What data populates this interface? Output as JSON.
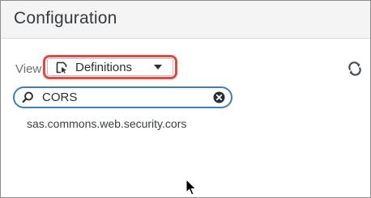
{
  "header": {
    "title": "Configuration"
  },
  "toolbar": {
    "view_label": "View",
    "view_select": {
      "selected": "Definitions",
      "icon": "definitions-icon"
    },
    "refresh_icon": "refresh-icon"
  },
  "search": {
    "value": "CORS",
    "icon": "search-icon",
    "clear_icon": "clear-icon"
  },
  "results": {
    "items": [
      {
        "label": "sas.commons.web.security.cors"
      }
    ]
  },
  "colors": {
    "highlight": "#e04a3f",
    "search_border": "#3d7fbe",
    "header_bg": "#f4f4f4"
  }
}
